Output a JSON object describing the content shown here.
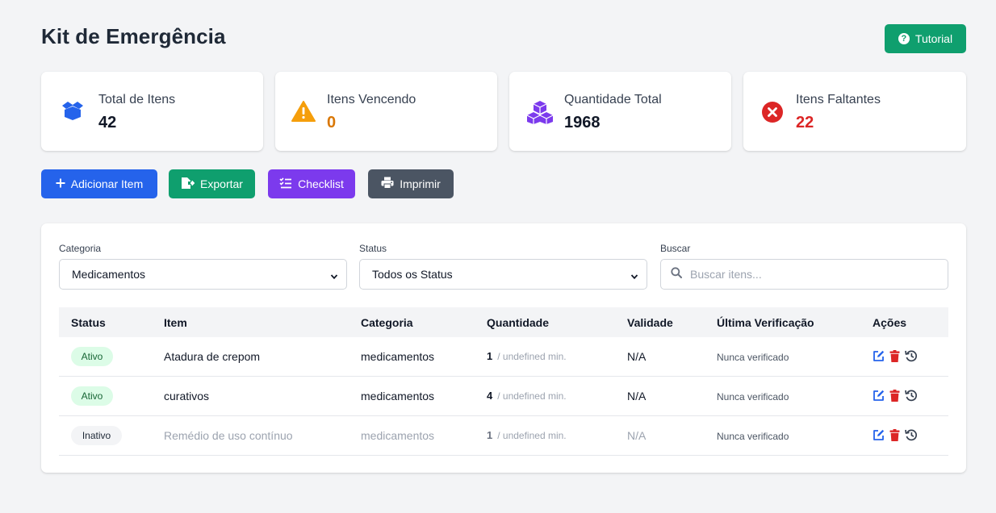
{
  "header": {
    "title": "Kit de Emergência",
    "tutorial_label": "Tutorial"
  },
  "stats": [
    {
      "label": "Total de Itens",
      "value": "42",
      "icon": "box-open-icon",
      "color": "#2563eb",
      "value_color": "#111827"
    },
    {
      "label": "Itens Vencendo",
      "value": "0",
      "icon": "warning-icon",
      "color": "#f59e0b",
      "value_color": "#d97706"
    },
    {
      "label": "Quantidade Total",
      "value": "1968",
      "icon": "cubes-icon",
      "color": "#7c3aed",
      "value_color": "#111827"
    },
    {
      "label": "Itens Faltantes",
      "value": "22",
      "icon": "x-circle-icon",
      "color": "#dc2626",
      "value_color": "#dc2626"
    }
  ],
  "actions": {
    "add": "Adicionar Item",
    "export": "Exportar",
    "checklist": "Checklist",
    "print": "Imprimir"
  },
  "filters": {
    "category_label": "Categoria",
    "category_value": "Medicamentos",
    "status_label": "Status",
    "status_value": "Todos os Status",
    "search_label": "Buscar",
    "search_placeholder": "Buscar itens..."
  },
  "table": {
    "headers": [
      "Status",
      "Item",
      "Categoria",
      "Quantidade",
      "Validade",
      "Última Verificação",
      "Ações"
    ],
    "rows": [
      {
        "status": "Ativo",
        "item": "Atadura de crepom",
        "category": "medicamentos",
        "qty": "1",
        "qty_min": "/ undefined min.",
        "validity": "N/A",
        "last_check": "Nunca verificado"
      },
      {
        "status": "Ativo",
        "item": "curativos",
        "category": "medicamentos",
        "qty": "4",
        "qty_min": "/ undefined min.",
        "validity": "N/A",
        "last_check": "Nunca verificado"
      },
      {
        "status": "Inativo",
        "item": "Remédio de uso contínuo",
        "category": "medicamentos",
        "qty": "1",
        "qty_min": "/ undefined min.",
        "validity": "N/A",
        "last_check": "Nunca verificado"
      }
    ]
  },
  "colors": {
    "tutorial": "#0f9f6e",
    "add": "#2563eb",
    "export": "#0f9f6e",
    "checklist": "#7c3aed",
    "print": "#4b5563",
    "edit": "#2563eb",
    "delete": "#dc2626"
  }
}
